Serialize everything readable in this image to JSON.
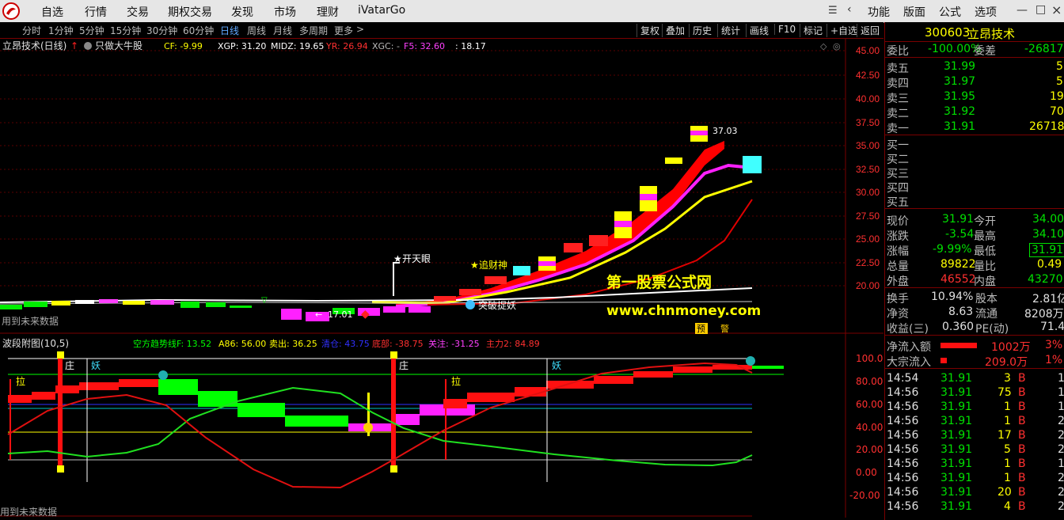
{
  "app": {
    "title": "iVatarGo"
  },
  "topmenu": [
    "自选",
    "行情",
    "交易",
    "期权交易",
    "发现",
    "市场",
    "理财"
  ],
  "rightmenu": [
    "功能",
    "版面",
    "公式",
    "选项"
  ],
  "periods": [
    "分时",
    "1分钟",
    "5分钟",
    "15分钟",
    "30分钟",
    "60分钟",
    "日线",
    "周线",
    "月线",
    "多周期",
    "更多"
  ],
  "active_period": "日线",
  "tools": [
    "复权",
    "叠加",
    "历史",
    "统计",
    "画线",
    "F10",
    "标记",
    "+自选",
    "返回"
  ],
  "main": {
    "title": "立昂技术(日线)",
    "formula": "只做大牛股",
    "indicators": [
      {
        "label": "CF: -9.99",
        "color": "#ffff00"
      },
      {
        "label": "XGP: 31.20",
        "color": "#ffffff"
      },
      {
        "label": "MIDZ: 19.65",
        "color": "#ffffff"
      },
      {
        "label": "YR: 26.94",
        "color": "#ff3030"
      },
      {
        "label": "XGC: -",
        "color": "#bbbbbb"
      },
      {
        "label": "F5: 32.60",
        "color": "#ff40ff"
      },
      {
        "label": ": 18.17",
        "color": "#ffffff"
      }
    ],
    "yaxis": [
      "45.00",
      "42.50",
      "40.00",
      "37.50",
      "35.00",
      "32.50",
      "30.00",
      "27.50",
      "25.00",
      "22.50",
      "20.00"
    ],
    "labels": {
      "kaitianyan": "开天眼",
      "zhuicaishen": "追财神",
      "tupo": "突破捉妖",
      "high": "37.03",
      "low": "17.01",
      "watermark1": "第一股票公式网",
      "watermark2": "www.chnmoney.com",
      "yu": "预",
      "jing": "警",
      "future": "用到未来数据"
    }
  },
  "sub": {
    "title": "波段附图(10,5)",
    "indicators": [
      {
        "label": "空方趋势线F: 13.52",
        "color": "#00ff00"
      },
      {
        "label": "A86: 56.00",
        "color": "#ffff00"
      },
      {
        "label": "卖出: 36.25",
        "color": "#ffff00"
      },
      {
        "label": "清仓: 43.75",
        "color": "#3030ff"
      },
      {
        "label": "底部: -38.75",
        "color": "#ff3030"
      },
      {
        "label": "关注: -31.25",
        "color": "#ff40ff"
      },
      {
        "label": "主力2: 84.89",
        "color": "#ff3030"
      }
    ],
    "yaxis": [
      "100.0",
      "80.00",
      "60.00",
      "40.00",
      "20.00",
      "0.00",
      "-20.00"
    ],
    "labels": {
      "zhuang": "庄",
      "yao": "妖",
      "la": "拉",
      "future": "用到未来数据"
    }
  },
  "stock": {
    "code": "300603",
    "name": "立昂技术"
  },
  "order": {
    "weibi_label": "委比",
    "weibi": "-100.00%",
    "weicha_label": "委差",
    "weicha": "-26817",
    "sells": [
      {
        "label": "卖五",
        "price": "31.99",
        "vol": "5"
      },
      {
        "label": "卖四",
        "price": "31.97",
        "vol": "5"
      },
      {
        "label": "卖三",
        "price": "31.95",
        "vol": "19"
      },
      {
        "label": "卖二",
        "price": "31.92",
        "vol": "70"
      },
      {
        "label": "卖一",
        "price": "31.91",
        "vol": "26718"
      }
    ],
    "buys": [
      "买一",
      "买二",
      "买三",
      "买四",
      "买五"
    ]
  },
  "quote": [
    {
      "l1": "现价",
      "v1": "31.91",
      "l2": "今开",
      "v2": "34.00",
      "c1": "#00e000",
      "c2": "#00e000"
    },
    {
      "l1": "涨跌",
      "v1": "-3.54",
      "l2": "最高",
      "v2": "34.10",
      "c1": "#00e000",
      "c2": "#00e000"
    },
    {
      "l1": "涨幅",
      "v1": "-9.99%",
      "l2": "最低",
      "v2": "31.91",
      "c1": "#00e000",
      "c2": "#00e000"
    },
    {
      "l1": "总量",
      "v1": "89822",
      "l2": "量比",
      "v2": "0.49",
      "c1": "#ffff00",
      "c2": "#ffff00"
    },
    {
      "l1": "外盘",
      "v1": "46552",
      "l2": "内盘",
      "v2": "43270",
      "c1": "#ff3030",
      "c2": "#00e000"
    }
  ],
  "stats": [
    {
      "l1": "换手",
      "v1": "10.94%",
      "l2": "股本",
      "v2": "2.81亿"
    },
    {
      "l1": "净资",
      "v1": "8.63",
      "l2": "流通",
      "v2": "8208万"
    },
    {
      "l1": "收益(三)",
      "v1": "0.360",
      "l2": "PE(动)",
      "v2": "71.4"
    }
  ],
  "flows": [
    {
      "label": "净流入额",
      "value": "1002万",
      "pct": "3%",
      "bar": 0.6
    },
    {
      "label": "大宗流入",
      "value": "209.0万",
      "pct": "1%",
      "bar": 0.1
    }
  ],
  "ticks": [
    {
      "t": "14:54",
      "p": "31.91",
      "v": "3",
      "s": "B",
      "n": "1"
    },
    {
      "t": "14:56",
      "p": "31.91",
      "v": "75",
      "s": "B",
      "n": "1"
    },
    {
      "t": "14:56",
      "p": "31.91",
      "v": "1",
      "s": "B",
      "n": "1"
    },
    {
      "t": "14:56",
      "p": "31.91",
      "v": "1",
      "s": "B",
      "n": "2"
    },
    {
      "t": "14:56",
      "p": "31.91",
      "v": "17",
      "s": "B",
      "n": "2"
    },
    {
      "t": "14:56",
      "p": "31.91",
      "v": "5",
      "s": "B",
      "n": "2"
    },
    {
      "t": "14:56",
      "p": "31.91",
      "v": "1",
      "s": "B",
      "n": "1"
    },
    {
      "t": "14:56",
      "p": "31.91",
      "v": "1",
      "s": "B",
      "n": "2"
    },
    {
      "t": "14:56",
      "p": "31.91",
      "v": "20",
      "s": "B",
      "n": "2"
    },
    {
      "t": "14:56",
      "p": "31.91",
      "v": "4",
      "s": "B",
      "n": "2"
    }
  ]
}
